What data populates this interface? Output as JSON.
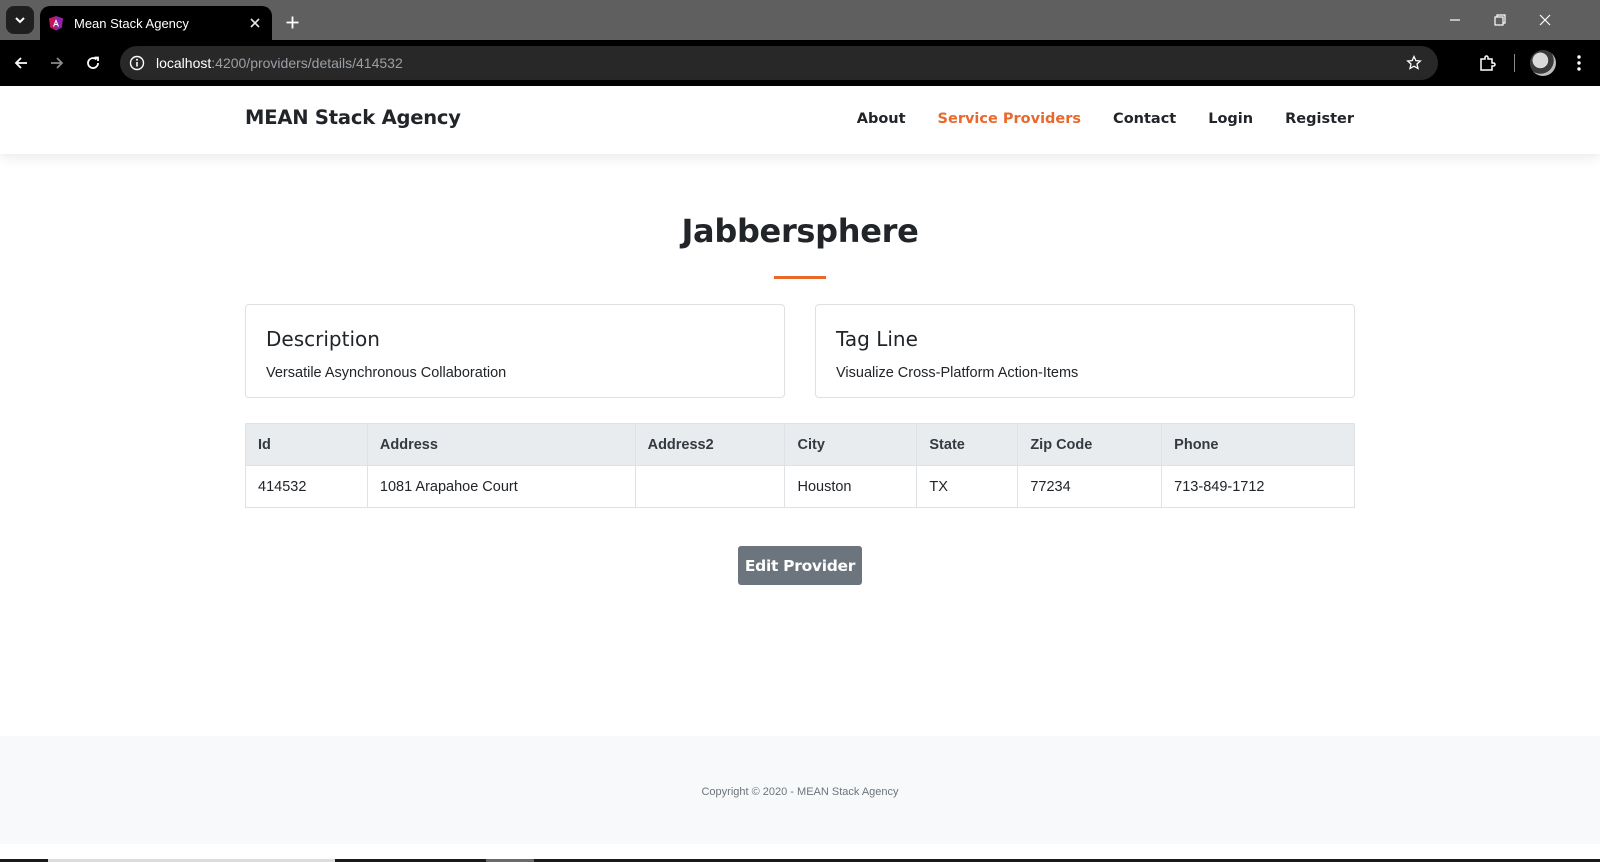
{
  "browser": {
    "tab_title": "Mean Stack Agency",
    "url_host": "localhost",
    "url_path": ":4200/providers/details/414532"
  },
  "navbar": {
    "brand": "MEAN Stack Agency",
    "links": [
      {
        "label": "About",
        "active": false
      },
      {
        "label": "Service Providers",
        "active": true
      },
      {
        "label": "Contact",
        "active": false
      },
      {
        "label": "Login",
        "active": false
      },
      {
        "label": "Register",
        "active": false
      }
    ],
    "accent_color": "#e9692c"
  },
  "provider": {
    "name": "Jabbersphere",
    "description_title": "Description",
    "description": "Versatile Asynchronous Collaboration",
    "tagline_title": "Tag Line",
    "tagline": "Visualize Cross-Platform Action-Items"
  },
  "table": {
    "headers": [
      "Id",
      "Address",
      "Address2",
      "City",
      "State",
      "Zip Code",
      "Phone"
    ],
    "rows": [
      [
        "414532",
        "1081 Arapahoe Court",
        "",
        "Houston",
        "TX",
        "77234",
        "713-849-1712"
      ]
    ]
  },
  "actions": {
    "edit_label": "Edit Provider"
  },
  "footer": {
    "copyright": "Copyright © 2020 - MEAN Stack Agency"
  }
}
